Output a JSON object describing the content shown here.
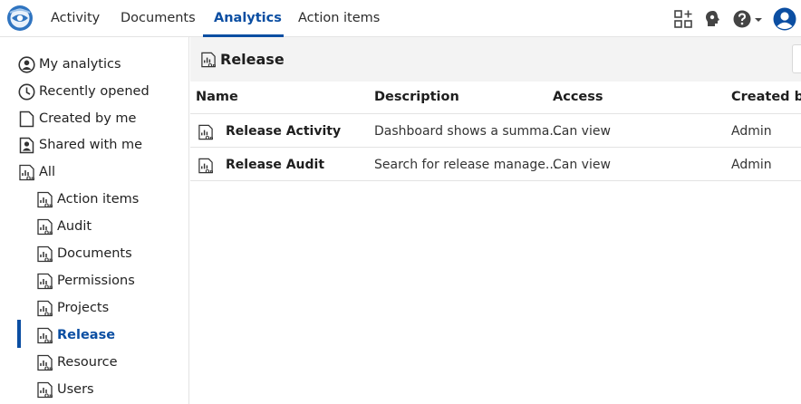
{
  "nav": {
    "tabs": [
      {
        "label": "Activity"
      },
      {
        "label": "Documents"
      },
      {
        "label": "Analytics"
      },
      {
        "label": "Action items"
      }
    ]
  },
  "sidebar": {
    "items": [
      {
        "label": "My analytics",
        "icon": "user-circle-icon"
      },
      {
        "label": "Recently opened",
        "icon": "clock-icon"
      },
      {
        "label": "Created by me",
        "icon": "document-icon"
      },
      {
        "label": "Shared with me",
        "icon": "shared-document-icon"
      },
      {
        "label": "All",
        "icon": "report-icon"
      }
    ],
    "folders": [
      {
        "label": "Action items"
      },
      {
        "label": "Audit"
      },
      {
        "label": "Documents"
      },
      {
        "label": "Permissions"
      },
      {
        "label": "Projects"
      },
      {
        "label": "Release"
      },
      {
        "label": "Resource"
      },
      {
        "label": "Users"
      }
    ]
  },
  "main": {
    "title": "Release",
    "columns": [
      "Name",
      "Description",
      "Access",
      "Created by"
    ],
    "rows": [
      {
        "name": "Release Activity",
        "description": "Dashboard shows a summa...",
        "access": "Can view",
        "created_by": "Admin"
      },
      {
        "name": "Release Audit",
        "description": "Search for release manage...",
        "access": "Can view",
        "created_by": "Admin"
      }
    ]
  },
  "colors": {
    "accent": "#0b4ea2",
    "header_band": "#f3f3f3"
  }
}
